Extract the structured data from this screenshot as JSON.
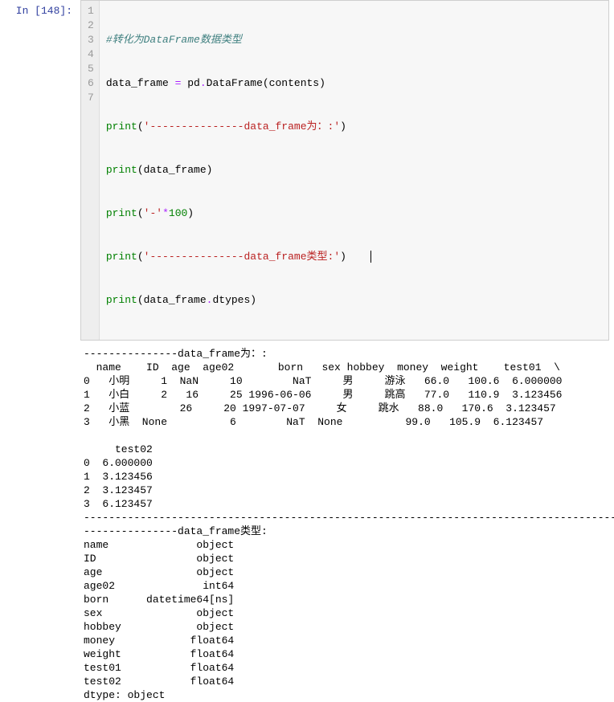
{
  "prompt": "In [148]:",
  "code": {
    "line_numbers": [
      "1",
      "2",
      "3",
      "4",
      "5",
      "6",
      "7"
    ],
    "l1_comment": "#转化为DataFrame数据类型",
    "l2_a": "data_frame ",
    "l2_op": "=",
    "l2_b": " pd",
    "l2_dot1": ".",
    "l2_c": "DataFrame(contents)",
    "l3_print": "print",
    "l3_p1": "(",
    "l3_s1": "'",
    "l3_dash": "---------------",
    "l3_txt": "data_frame为：:",
    "l3_s2": "'",
    "l3_p2": ")",
    "l4_print": "print",
    "l4_rest": "(data_frame)",
    "l5_print": "print",
    "l5_p1": "(",
    "l5_s1": "'",
    "l5_dash": "-",
    "l5_s2": "'",
    "l5_op": "*",
    "l5_num": "100",
    "l5_p2": ")",
    "l6_print": "print",
    "l6_p1": "(",
    "l6_s1": "'",
    "l6_dash": "---------------",
    "l6_txt_a": "data_frame",
    "l6_txt_cjk": "类型",
    "l6_txt_b": ":",
    "l6_s2": "'",
    "l6_p2": ")",
    "l7_print": "print",
    "l7_p1": "(data_frame",
    "l7_dot": ".",
    "l7_rest": "dtypes)"
  },
  "output": "---------------data_frame为：:\n  name    ID  age  age02       born   sex hobbey  money  weight    test01  \\\n0   小明     1  NaN     10        NaT     男     游泳   66.0   100.6  6.000000   \n1   小白     2   16     25 1996-06-06     男     跳高   77.0   110.9  3.123456   \n2   小蓝        26     20 1997-07-07     女     跳水   88.0   170.6  3.123457   \n3   小黑  None          6        NaT  None          99.0   105.9  6.123457   \n\n     test02  \n0  6.000000  \n1  3.123456  \n2  3.123457  \n3  6.123457  \n----------------------------------------------------------------------------------------------------\n---------------data_frame类型:\nname              object\nID                object\nage               object\nage02              int64\nborn      datetime64[ns]\nsex               object\nhobbey            object\nmoney            float64\nweight           float64\ntest01           float64\ntest02           float64\ndtype: object"
}
